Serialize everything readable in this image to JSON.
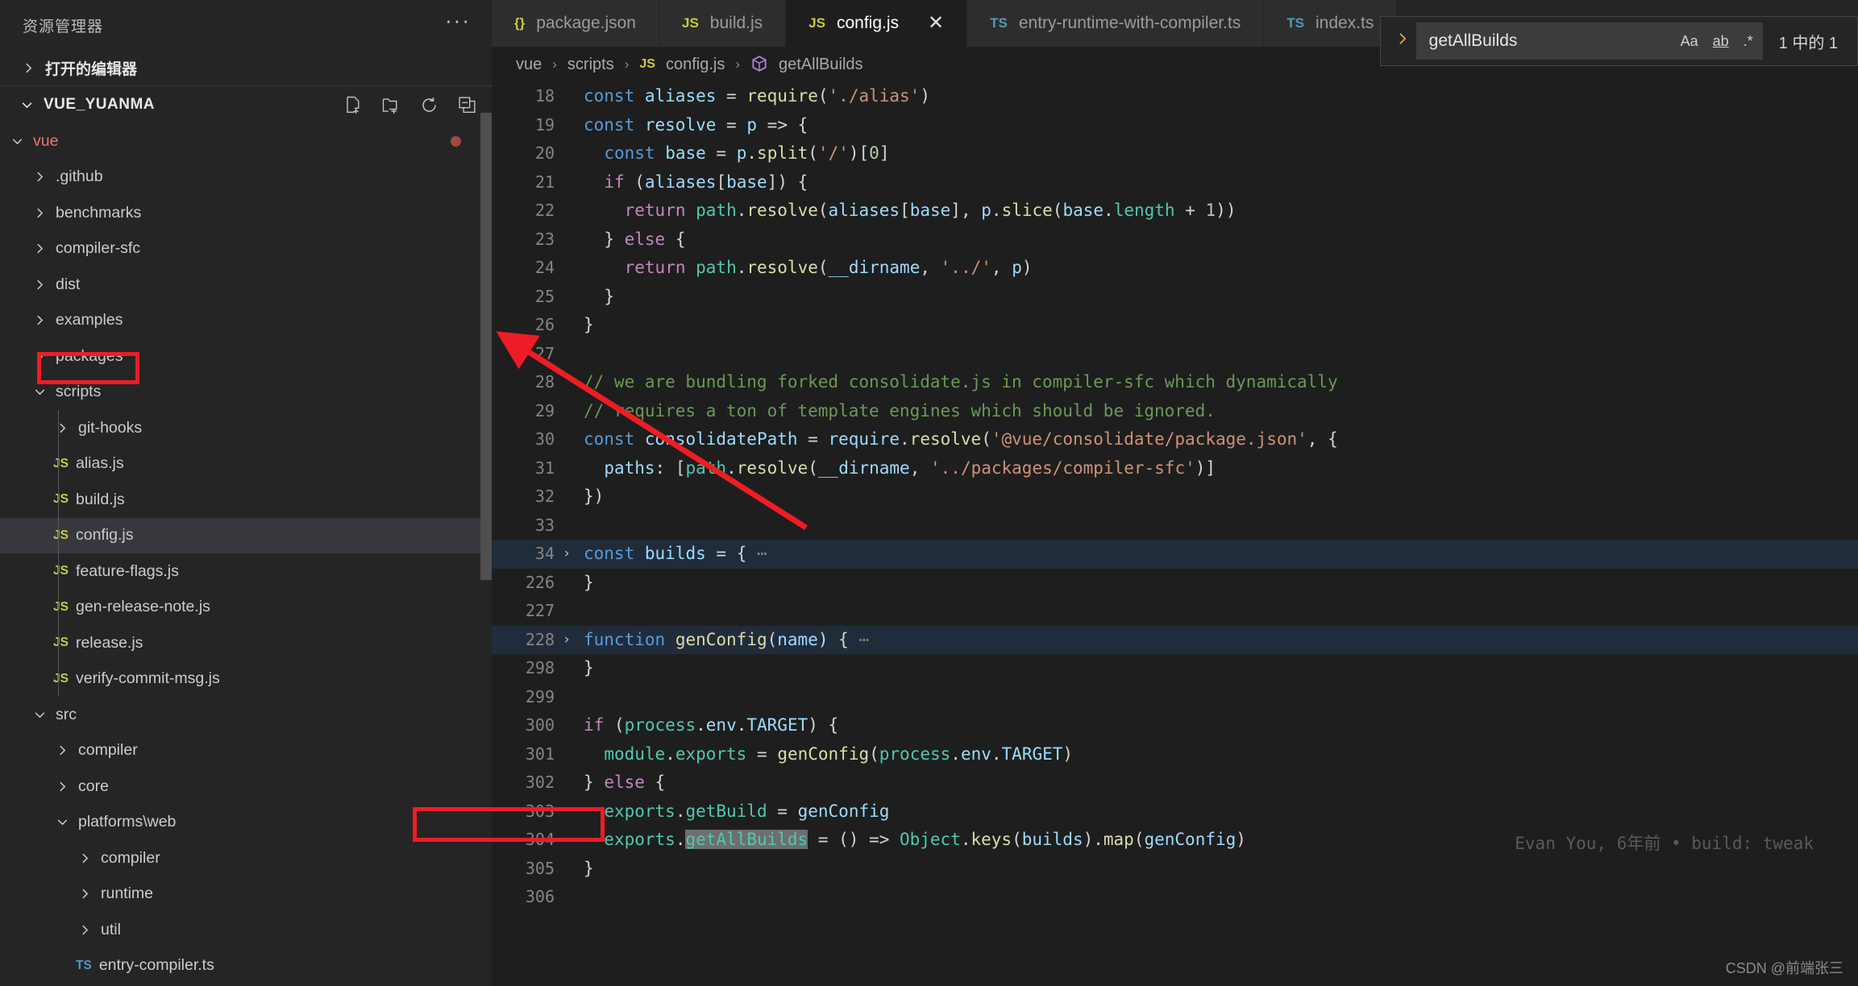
{
  "sidebar": {
    "title": "资源管理器",
    "more_label": "···",
    "open_editors_label": "打开的编辑器",
    "workspace_label": "VUE_YUANMA",
    "head_icons": [
      "new-file-icon",
      "new-folder-icon",
      "refresh-icon",
      "collapse-all-icon"
    ],
    "tree": [
      {
        "label": "vue",
        "depth": 1,
        "type": "folder",
        "state": "open",
        "accent": "vue",
        "modified": true
      },
      {
        "label": ".github",
        "depth": 2,
        "type": "folder",
        "state": "closed"
      },
      {
        "label": "benchmarks",
        "depth": 2,
        "type": "folder",
        "state": "closed"
      },
      {
        "label": "compiler-sfc",
        "depth": 2,
        "type": "folder",
        "state": "closed"
      },
      {
        "label": "dist",
        "depth": 2,
        "type": "folder",
        "state": "closed"
      },
      {
        "label": "examples",
        "depth": 2,
        "type": "folder",
        "state": "closed"
      },
      {
        "label": "packages",
        "depth": 2,
        "type": "folder",
        "state": "closed"
      },
      {
        "label": "scripts",
        "depth": 2,
        "type": "folder",
        "state": "open"
      },
      {
        "label": "git-hooks",
        "depth": 3,
        "type": "folder",
        "state": "closed"
      },
      {
        "label": "alias.js",
        "depth": 3,
        "type": "file",
        "icon": "JS"
      },
      {
        "label": "build.js",
        "depth": 3,
        "type": "file",
        "icon": "JS"
      },
      {
        "label": "config.js",
        "depth": 3,
        "type": "file",
        "icon": "JS",
        "selected": true,
        "highlighted": true
      },
      {
        "label": "feature-flags.js",
        "depth": 3,
        "type": "file",
        "icon": "JS"
      },
      {
        "label": "gen-release-note.js",
        "depth": 3,
        "type": "file",
        "icon": "JS"
      },
      {
        "label": "release.js",
        "depth": 3,
        "type": "file",
        "icon": "JS"
      },
      {
        "label": "verify-commit-msg.js",
        "depth": 3,
        "type": "file",
        "icon": "JS"
      },
      {
        "label": "src",
        "depth": 2,
        "type": "folder",
        "state": "open"
      },
      {
        "label": "compiler",
        "depth": 3,
        "type": "folder",
        "state": "closed"
      },
      {
        "label": "core",
        "depth": 3,
        "type": "folder",
        "state": "closed"
      },
      {
        "label": "platforms\\web",
        "depth": 3,
        "type": "folder",
        "state": "open"
      },
      {
        "label": "compiler",
        "depth": 4,
        "type": "folder",
        "state": "closed"
      },
      {
        "label": "runtime",
        "depth": 4,
        "type": "folder",
        "state": "closed"
      },
      {
        "label": "util",
        "depth": 4,
        "type": "folder",
        "state": "closed"
      },
      {
        "label": "entry-compiler.ts",
        "depth": 4,
        "type": "file",
        "icon": "TS"
      }
    ]
  },
  "tabs": [
    {
      "label": "package.json",
      "icon": "{}",
      "icon_kind": "json",
      "active": false,
      "closable": false
    },
    {
      "label": "build.js",
      "icon": "JS",
      "icon_kind": "js",
      "active": false,
      "closable": false
    },
    {
      "label": "config.js",
      "icon": "JS",
      "icon_kind": "js",
      "active": true,
      "closable": true,
      "close_label": "✕"
    },
    {
      "label": "entry-runtime-with-compiler.ts",
      "icon": "TS",
      "icon_kind": "ts",
      "active": false,
      "closable": false
    },
    {
      "label": "index.ts",
      "icon": "TS",
      "icon_kind": "ts",
      "active": false,
      "closable": false
    }
  ],
  "breadcrumb": {
    "items": [
      "vue",
      "scripts",
      "config.js",
      "getAllBuilds"
    ],
    "separator": "›",
    "file_icon": "JS",
    "symbol_icon": "symbol-method-icon"
  },
  "find": {
    "toggle_icon": "chevron-right-icon",
    "query": "getAllBuilds",
    "match_case_label": "Aa",
    "whole_word_label": "ab",
    "regex_label": ".*",
    "result_count": "1 中的 1"
  },
  "editor": {
    "lines": [
      {
        "num": "18",
        "fold": "",
        "text": "const aliases = require('./alias')"
      },
      {
        "num": "19",
        "fold": "",
        "text": "const resolve = p => {"
      },
      {
        "num": "20",
        "fold": "",
        "text": "  const base = p.split('/')[0]"
      },
      {
        "num": "21",
        "fold": "",
        "text": "  if (aliases[base]) {"
      },
      {
        "num": "22",
        "fold": "",
        "text": "    return path.resolve(aliases[base], p.slice(base.length + 1))"
      },
      {
        "num": "23",
        "fold": "",
        "text": "  } else {"
      },
      {
        "num": "24",
        "fold": "",
        "text": "    return path.resolve(__dirname, '../', p)"
      },
      {
        "num": "25",
        "fold": "",
        "text": "  }"
      },
      {
        "num": "26",
        "fold": "",
        "text": "}"
      },
      {
        "num": "27",
        "fold": "",
        "text": ""
      },
      {
        "num": "28",
        "fold": "",
        "text": "// we are bundling forked consolidate.js in compiler-sfc which dynamically"
      },
      {
        "num": "29",
        "fold": "",
        "text": "// requires a ton of template engines which should be ignored."
      },
      {
        "num": "30",
        "fold": "",
        "text": "const consolidatePath = require.resolve('@vue/consolidate/package.json', {"
      },
      {
        "num": "31",
        "fold": "",
        "text": "  paths: [path.resolve(__dirname, '../packages/compiler-sfc')]"
      },
      {
        "num": "32",
        "fold": "",
        "text": "})"
      },
      {
        "num": "33",
        "fold": "",
        "text": ""
      },
      {
        "num": "34",
        "fold": "›",
        "text": "const builds = {⋯",
        "folded": true
      },
      {
        "num": "226",
        "fold": "",
        "text": "}"
      },
      {
        "num": "227",
        "fold": "",
        "text": ""
      },
      {
        "num": "228",
        "fold": "›",
        "text": "function genConfig(name) {⋯",
        "folded": true
      },
      {
        "num": "298",
        "fold": "",
        "text": "}"
      },
      {
        "num": "299",
        "fold": "",
        "text": ""
      },
      {
        "num": "300",
        "fold": "",
        "text": "if (process.env.TARGET) {"
      },
      {
        "num": "301",
        "fold": "",
        "text": "  module.exports = genConfig(process.env.TARGET)"
      },
      {
        "num": "302",
        "fold": "",
        "text": "} else {"
      },
      {
        "num": "303",
        "fold": "",
        "text": "  exports.getBuild = genConfig"
      },
      {
        "num": "304",
        "fold": "",
        "text": "  exports.getAllBuilds = () => Object.keys(builds).map(genConfig)"
      },
      {
        "num": "305",
        "fold": "",
        "text": "}"
      },
      {
        "num": "306",
        "fold": "",
        "text": ""
      }
    ],
    "blame": "Evan You, 6年前 • build: tweak"
  },
  "watermark": "CSDN @前端张三",
  "colors": {
    "accent_red": "#ee1c25",
    "sidebar_bg": "#252526",
    "editor_bg": "#1e1e1e",
    "selected_row": "#37373d",
    "folded_line": "#212c3b"
  }
}
